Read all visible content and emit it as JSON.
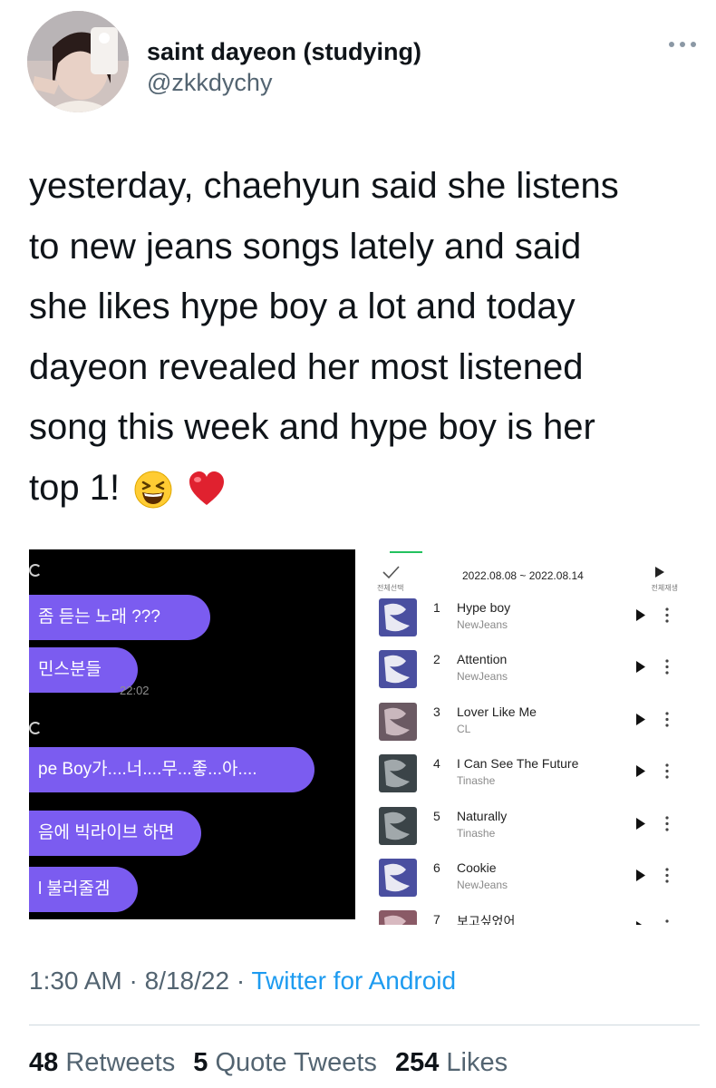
{
  "author": {
    "display_name": "saint dayeon (studying)",
    "handle": "@zkkdychy",
    "avatar_icon": "profile-photo"
  },
  "tweet": {
    "lines": [
      "yesterday, chaehyun said she listens",
      "to new jeans songs lately and said",
      "she likes hype boy a lot and today",
      "dayeon revealed her most listened",
      "song this week and hype boy is her",
      "top 1!"
    ],
    "emojis": [
      "grinning-squinting-face",
      "red-heart"
    ]
  },
  "chat": {
    "messages": [
      "좀 듣는 노래 ???",
      "민스분들",
      "pe Boy가....너....무...좋...아....",
      "음에 빅라이브 하면",
      "l 불러줄겜"
    ],
    "time": "22:02"
  },
  "playlist": {
    "select_all": "전체선택",
    "date_range": "2022.08.08 ~ 2022.08.14",
    "play_all": "전체재생",
    "accent": "#23c15e",
    "tracks": [
      {
        "rank": "1",
        "title": "Hype boy",
        "artist": "NewJeans"
      },
      {
        "rank": "2",
        "title": "Attention",
        "artist": "NewJeans"
      },
      {
        "rank": "3",
        "title": "Lover Like Me",
        "artist": "CL"
      },
      {
        "rank": "4",
        "title": "I Can See The Future",
        "artist": "Tinashe"
      },
      {
        "rank": "5",
        "title": "Naturally",
        "artist": "Tinashe"
      },
      {
        "rank": "6",
        "title": "Cookie",
        "artist": "NewJeans"
      },
      {
        "rank": "7",
        "title": "보고싶었어",
        "artist": ""
      }
    ]
  },
  "meta": {
    "time": "1:30 AM",
    "date": "8/18/22",
    "separator": "·",
    "source": "Twitter for Android"
  },
  "stats": {
    "retweets_count": "48",
    "retweets_label": "Retweets",
    "quotes_count": "5",
    "quotes_label": "Quote Tweets",
    "likes_count": "254",
    "likes_label": "Likes"
  },
  "colors": {
    "text": "#0f1419",
    "secondary": "#536471",
    "link": "#1d9bf0",
    "bubble": "#7b5cf0"
  }
}
